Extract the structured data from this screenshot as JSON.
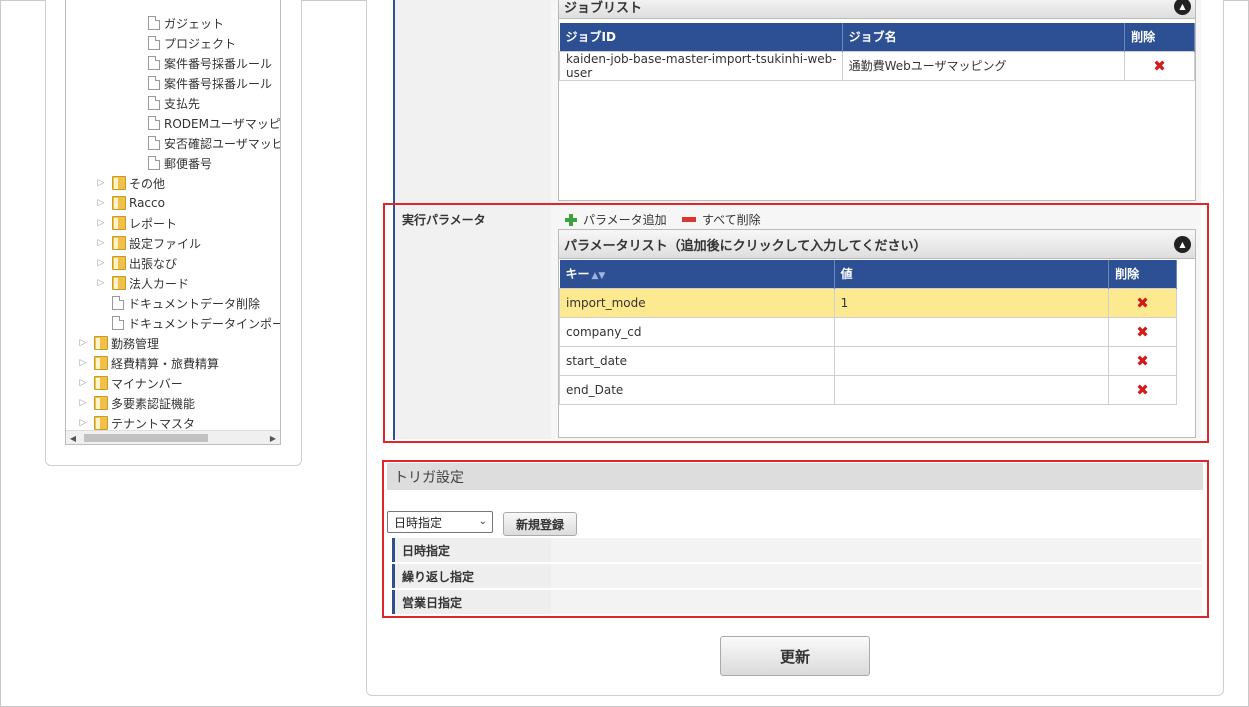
{
  "tree": {
    "items": [
      {
        "label": "ガジェット",
        "type": "doc",
        "level": 3
      },
      {
        "label": "プロジェクト",
        "type": "doc",
        "level": 3
      },
      {
        "label": "案件番号採番ルール",
        "type": "doc",
        "level": 3
      },
      {
        "label": "案件番号採番ルール",
        "type": "doc",
        "level": 3
      },
      {
        "label": "支払先",
        "type": "doc",
        "level": 3
      },
      {
        "label": "RODEMユーザマッピ",
        "type": "doc",
        "level": 3
      },
      {
        "label": "安否確認ユーザマッピ",
        "type": "doc",
        "level": 3
      },
      {
        "label": "郵便番号",
        "type": "doc",
        "level": 3
      },
      {
        "label": "その他",
        "type": "folder",
        "level": 2
      },
      {
        "label": "Racco",
        "type": "folder",
        "level": 2
      },
      {
        "label": "レポート",
        "type": "folder",
        "level": 2
      },
      {
        "label": "設定ファイル",
        "type": "folder",
        "level": 2
      },
      {
        "label": "出張なび",
        "type": "folder",
        "level": 2
      },
      {
        "label": "法人カード",
        "type": "folder",
        "level": 2
      },
      {
        "label": "ドキュメントデータ削除",
        "type": "doc",
        "level": 2
      },
      {
        "label": "ドキュメントデータインポー",
        "type": "doc",
        "level": 2
      },
      {
        "label": "勤務管理",
        "type": "folder",
        "level": 1
      },
      {
        "label": "経費精算・旅費精算",
        "type": "folder",
        "level": 1
      },
      {
        "label": "マイナンバー",
        "type": "folder",
        "level": 1
      },
      {
        "label": "多要素認証機能",
        "type": "folder",
        "level": 1
      },
      {
        "label": "テナントマスタ",
        "type": "folder",
        "level": 1
      }
    ]
  },
  "job_list": {
    "title": "ジョブリスト",
    "columns": [
      "ジョブID",
      "ジョブ名",
      "削除"
    ],
    "rows": [
      {
        "job_id": "kaiden-job-base-master-import-tsukinhi-web-user",
        "job_name": "通勤費Webユーザマッピング"
      }
    ]
  },
  "params": {
    "label": "実行パラメータ",
    "add_label": "パラメータ追加",
    "delete_all_label": "すべて削除",
    "list_title": "パラメータリスト（追加後にクリックして入力してください）",
    "columns": [
      "キー",
      "値",
      "削除"
    ],
    "rows": [
      {
        "key": "import_mode",
        "value": "1",
        "selected": true
      },
      {
        "key": "company_cd",
        "value": "",
        "selected": false
      },
      {
        "key": "start_date",
        "value": "",
        "selected": false
      },
      {
        "key": "end_Date",
        "value": "",
        "selected": false
      }
    ]
  },
  "trigger": {
    "title": "トリガ設定",
    "select_value": "日時指定",
    "register_label": "新規登録",
    "rows": [
      "日時指定",
      "繰り返し指定",
      "営業日指定"
    ]
  },
  "update_label": "更新",
  "delete_glyph": "✖",
  "colors": {
    "header_blue": "#2d4f93",
    "highlight_red": "#e0252d",
    "selected_row": "#fde98f"
  }
}
